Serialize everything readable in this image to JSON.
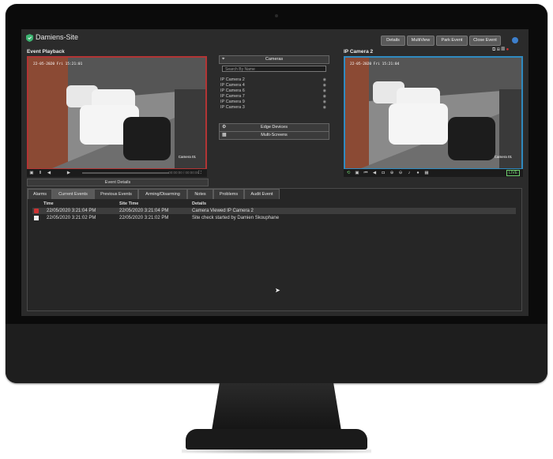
{
  "app": {
    "title": "Damiens-Site"
  },
  "toolbar": {
    "buttons": [
      "Details",
      "MultiView",
      "Park Event",
      "Close Event"
    ]
  },
  "left_panel": {
    "label": "Event Playback",
    "timestamp": "22-05-2020 Fri 15:21:01",
    "camera_overlay": "Camera 01",
    "playback_time": "00:00:00 / 00:00:00",
    "event_details_button": "Event Details"
  },
  "middle_panel": {
    "cameras_header": "Cameras",
    "search_placeholder": "Search By Name",
    "cameras": [
      "IP Camera 2",
      "IP Camera 4",
      "IP Camera 6",
      "IP Camera 7",
      "IP Camera 9",
      "IP Camera 3"
    ],
    "edge_devices_header": "Edge Devices",
    "multi_screens_header": "Multi-Screens"
  },
  "right_panel": {
    "label": "IP Camera 2",
    "timestamp": "22-05-2020 Fri 15:21:04",
    "camera_overlay": "Camera 01",
    "live_badge": "LIVE"
  },
  "tabs": [
    "Alarms",
    "Current Events",
    "Previous Events",
    "Arming/Disarming",
    "Notes",
    "Problems",
    "Audit Event"
  ],
  "active_tab": "Current Events",
  "events_table": {
    "headers": {
      "time": "Time",
      "site_time": "Site Time",
      "details": "Details"
    },
    "rows": [
      {
        "time": "22/05/2020 3:21:04 PM",
        "site_time": "22/05/2020 3:21:04 PM",
        "details": "Camera Viewed IP Camera 2",
        "icon": "camera-red-icon"
      },
      {
        "time": "22/05/2020 3:21:02 PM",
        "site_time": "22/05/2020 3:21:02 PM",
        "details": "Site check started by Damien Skouphane",
        "icon": "check-icon"
      }
    ]
  },
  "colors": {
    "accent_red": "#b23535",
    "accent_blue": "#2f8ac0",
    "logo_green": "#3cb371",
    "live_green": "#6fd06f"
  }
}
